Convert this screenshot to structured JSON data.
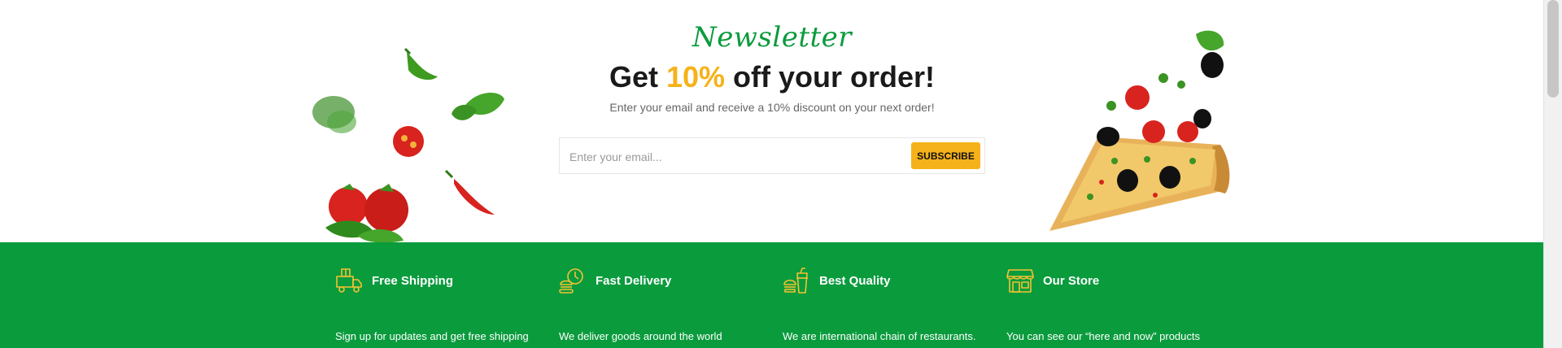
{
  "newsletter": {
    "script_title": "Newsletter",
    "heading_before": "Get ",
    "heading_accent": "10%",
    "heading_after": " off your order!",
    "subtitle": "Enter your email and receive a 10% discount on your next order!",
    "email_placeholder": "Enter your email...",
    "subscribe_label": "SUBSCRIBE"
  },
  "features": [
    {
      "title": "Free Shipping",
      "description": "Sign up for updates and get free shipping",
      "icon": "delivery-truck-icon"
    },
    {
      "title": "Fast Delivery",
      "description": "We deliver goods around the world",
      "icon": "fast-food-icon"
    },
    {
      "title": "Best Quality",
      "description": "We are international chain of restaurants.",
      "icon": "burger-drink-icon"
    },
    {
      "title": "Our Store",
      "description": "You can see our “here and now” products",
      "icon": "storefront-icon"
    }
  ],
  "colors": {
    "brand_green": "#0a9b3d",
    "accent_yellow": "#f6b21a",
    "icon_yellow": "#f3c232",
    "heading_dark": "#1a1a1a"
  }
}
